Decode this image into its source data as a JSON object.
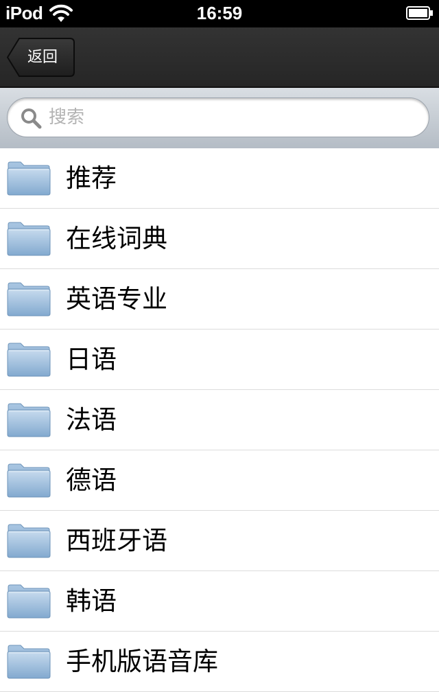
{
  "status_bar": {
    "carrier": "iPod",
    "time": "16:59",
    "wifi_icon": "wifi-icon",
    "battery_icon": "battery-icon"
  },
  "nav_bar": {
    "back_label": "返回"
  },
  "search": {
    "placeholder": "搜索",
    "icon": "search-icon"
  },
  "list": {
    "icon": "folder-icon",
    "items": [
      {
        "label": "推荐"
      },
      {
        "label": "在线词典"
      },
      {
        "label": "英语专业"
      },
      {
        "label": "日语"
      },
      {
        "label": "法语"
      },
      {
        "label": "德语"
      },
      {
        "label": "西班牙语"
      },
      {
        "label": "韩语"
      },
      {
        "label": "手机版语音库"
      }
    ]
  },
  "colors": {
    "status_bar_bg": "#000000",
    "nav_bar_bg": "#2b2b2b",
    "search_bar_bg": "#c5ccd3",
    "folder_blue": "#8fb3d6",
    "separator": "#dcdcdc"
  }
}
